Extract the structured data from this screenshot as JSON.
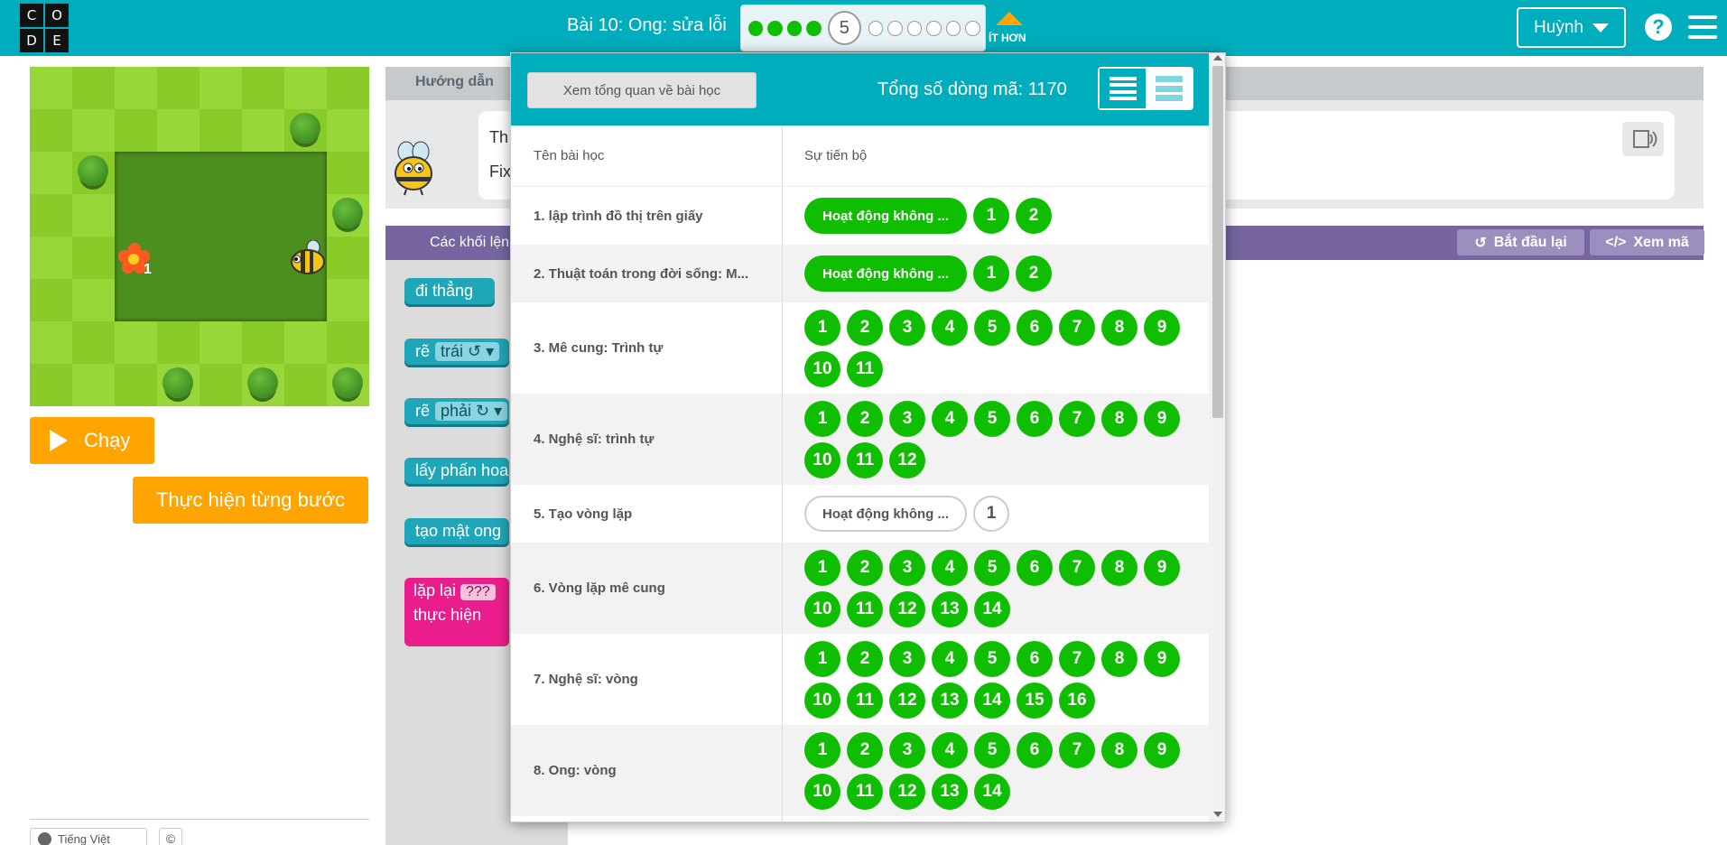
{
  "logo": [
    "C",
    "O",
    "D",
    "E"
  ],
  "header": {
    "lesson_title": "Bài 10: Ong: sửa lỗi",
    "current_puzzle": "5",
    "completed_puzzles": 4,
    "remaining_puzzles": 6,
    "less_label": "ÍT HƠN",
    "user_name": "Huỳnh",
    "help_label": "?"
  },
  "game": {
    "flower_count": "1",
    "run_label": "Chạy",
    "step_label": "Thực hiện từng bước"
  },
  "footer": {
    "language": "Tiếng Việt",
    "copyright": "©"
  },
  "instructions": {
    "tab_label": "Hướng dẫn",
    "text_line1": "Th",
    "text_line2": "Fix"
  },
  "workspace": {
    "blocks_title": "Các khối lệnh",
    "reset_label": "Bắt đầu lại",
    "show_code_label": "Xem mã",
    "blocks": [
      {
        "text": "đi thẳng",
        "dropdown": ""
      },
      {
        "text": "rẽ",
        "dropdown": "trái ↺ ▾"
      },
      {
        "text": "rẽ",
        "dropdown": "phải ↻ ▾"
      },
      {
        "text": "lấy phấn hoa",
        "dropdown": ""
      },
      {
        "text": "tạo mật ong",
        "dropdown": ""
      }
    ],
    "repeat_block": {
      "line1": "lặp lại",
      "slot": "???",
      "line2": "thực hiện"
    }
  },
  "progress_overlay": {
    "overview_button": "Xem tổng quan về bài học",
    "total_lines": "Tổng số dòng mã: 1170",
    "column_lesson": "Tên bài học",
    "column_progress": "Sự tiến bộ",
    "activity_label": "Hoạt động không ...",
    "lessons": [
      {
        "name": "1. lập trình đồ thị trên giấy",
        "pill": true,
        "pill_done": true,
        "count": 2,
        "done": true
      },
      {
        "name": "2. Thuật toán trong đời sống: M...",
        "pill": true,
        "pill_done": true,
        "count": 2,
        "done": true
      },
      {
        "name": "3. Mê cung: Trình tự",
        "pill": false,
        "count": 11,
        "done": true
      },
      {
        "name": "4. Nghệ sĩ: trình tự",
        "pill": false,
        "count": 12,
        "done": true
      },
      {
        "name": "5. Tạo vòng lặp",
        "pill": true,
        "pill_done": false,
        "count": 1,
        "done": false
      },
      {
        "name": "6. Vòng lặp mê cung",
        "pill": false,
        "count": 14,
        "done": true
      },
      {
        "name": "7. Nghệ sĩ: vòng",
        "pill": false,
        "count": 16,
        "done": true
      },
      {
        "name": "8. Ong: vòng",
        "pill": false,
        "count": 14,
        "done": true
      }
    ]
  }
}
